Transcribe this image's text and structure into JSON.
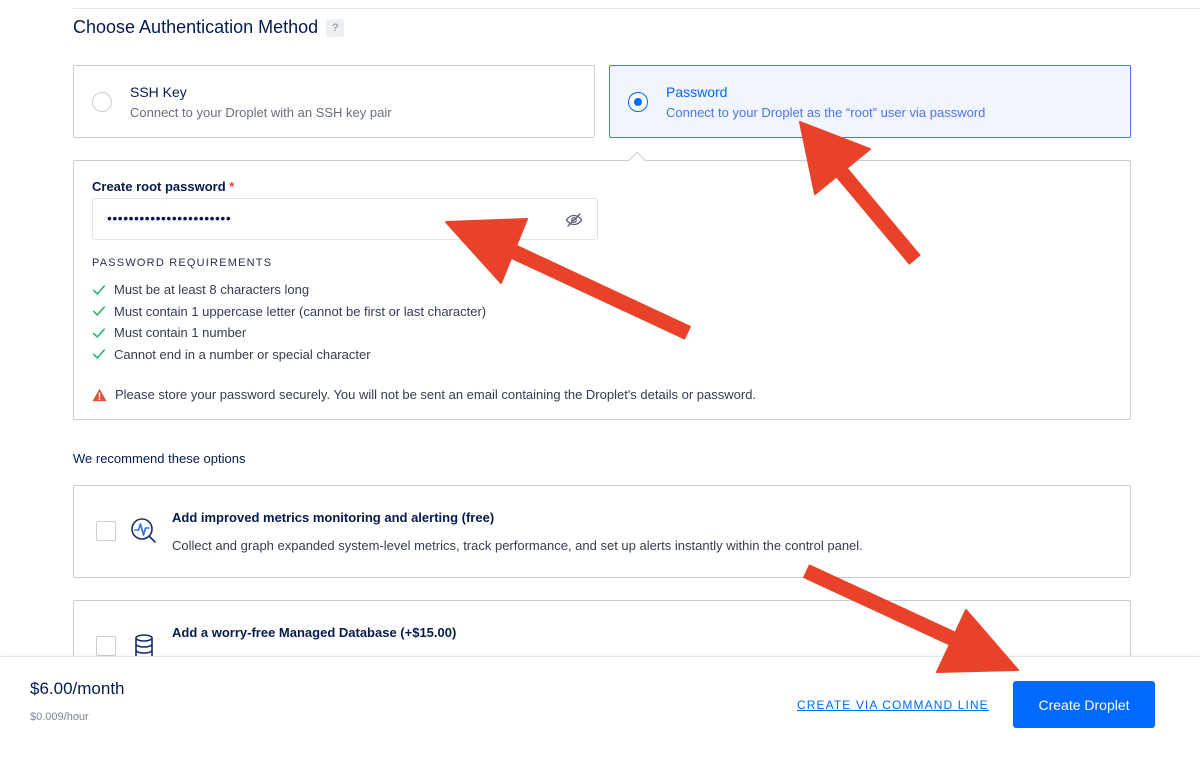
{
  "section": {
    "title": "Choose Authentication Method",
    "help": "?"
  },
  "auth_options": {
    "ssh": {
      "title": "SSH Key",
      "desc": "Connect to your Droplet with an SSH key pair",
      "selected": false
    },
    "password": {
      "title": "Password",
      "desc": "Connect to your Droplet as the “root” user via password",
      "selected": true
    }
  },
  "password_panel": {
    "label": "Create root password",
    "required_mark": "*",
    "value_masked": "•••••••••••••••••••••••",
    "requirements_heading": "PASSWORD REQUIREMENTS",
    "requirements": [
      "Must be at least 8 characters long",
      "Must contain 1 uppercase letter (cannot be first or last character)",
      "Must contain 1 number",
      "Cannot end in a number or special character"
    ],
    "warning": "Please store your password securely. You will not be sent an email containing the Droplet's details or password."
  },
  "recommendations": {
    "title": "We recommend these options",
    "metrics": {
      "title": "Add improved metrics monitoring and alerting (free)",
      "desc": "Collect and graph expanded system-level metrics, track performance, and set up alerts instantly within the control panel."
    },
    "database": {
      "title": "Add a worry-free Managed Database (+$15.00)"
    }
  },
  "footer": {
    "price": "$6.00/month",
    "price_hour": "$0.009/hour",
    "cli_link": "CREATE VIA COMMAND LINE",
    "create_button": "Create Droplet"
  },
  "colors": {
    "accent": "#0069ff",
    "selected_bg": "#f0f5fe",
    "check": "#2eb369",
    "warning": "#e0503a",
    "annotation_arrow": "#e8432a"
  },
  "icons": {
    "eye": "eye-slash-icon",
    "check": "check-icon",
    "warning": "warning-triangle-icon",
    "metrics": "metrics-magnifier-icon",
    "database": "database-icon"
  }
}
